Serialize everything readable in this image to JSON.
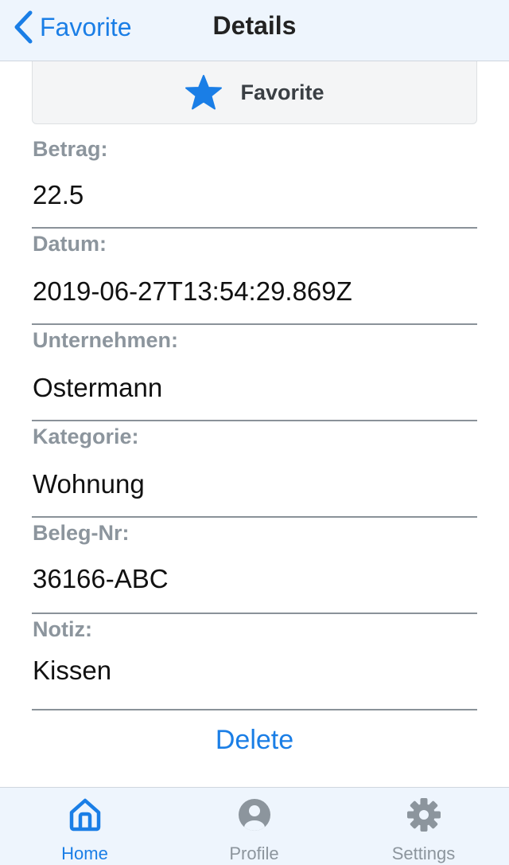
{
  "header": {
    "back_label": "Favorite",
    "title": "Details"
  },
  "favorite": {
    "label": "Favorite",
    "icon": "star-icon",
    "color": "#1a7ee6"
  },
  "fields": [
    {
      "label": "Betrag:",
      "value": "22.5"
    },
    {
      "label": "Datum:",
      "value": "2019-06-27T13:54:29.869Z"
    },
    {
      "label": "Unternehmen:",
      "value": "Ostermann"
    },
    {
      "label": "Kategorie:",
      "value": "Wohnung"
    },
    {
      "label": "Beleg-Nr:",
      "value": "36166-ABC"
    },
    {
      "label": "Notiz:",
      "value": "Kissen"
    }
  ],
  "delete_label": "Delete",
  "tabbar": {
    "items": [
      {
        "label": "Home",
        "icon": "home-icon",
        "active": true
      },
      {
        "label": "Profile",
        "icon": "user-circle-icon",
        "active": false
      },
      {
        "label": "Settings",
        "icon": "gear-icon",
        "active": false
      }
    ]
  },
  "colors": {
    "accent": "#1a7ee6",
    "label_gray": "#8c959d",
    "bar_background": "#eef5fd"
  }
}
